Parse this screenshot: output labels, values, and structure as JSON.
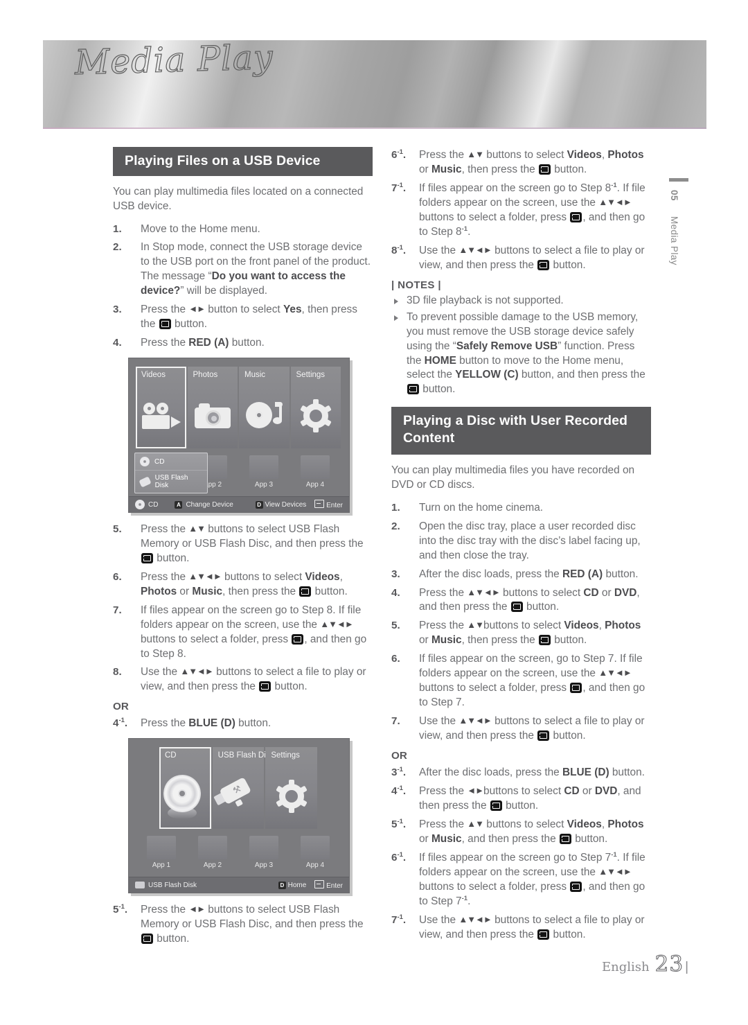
{
  "banner": {
    "title": "Media Play"
  },
  "chapter_tab": {
    "number": "05",
    "name": "Media Play"
  },
  "footer": {
    "language": "English",
    "page": "23",
    "rule": "|"
  },
  "left": {
    "section_title": "Playing Files on a USB Device",
    "intro": "You can play multimedia files located on a connected USB device.",
    "steps": [
      {
        "num": "1.",
        "html": "Move to the Home menu."
      },
      {
        "num": "2.",
        "html": "In Stop mode, connect the USB storage device to the USB port on the front panel of the product. The message “<b>Do you want to access the device?</b>” will be displayed."
      },
      {
        "num": "3.",
        "html": "Press the <span class=\"arw\">◄►</span> button to select <b>Yes</b>, then press the <span class=\"ent\"></span> button."
      },
      {
        "num": "4.",
        "html": "Press the <b>RED (A)</b> button."
      }
    ],
    "steps2": [
      {
        "num": "5.",
        "html": "Press the <span class=\"arw\">▲▼</span> buttons to select USB Flash Memory or USB Flash Disc, and then press the <span class=\"ent\"></span> button."
      },
      {
        "num": "6.",
        "html": "Press the <span class=\"arw\">▲▼◄►</span> buttons to select <b>Videos</b>, <b>Photos</b> or <b>Music</b>, then press the <span class=\"ent\"></span> button."
      },
      {
        "num": "7.",
        "html": "If files appear on the screen go to Step 8. If file folders appear on the screen, use the <span class=\"arw\">▲▼◄►</span> buttons to select a folder, press <span class=\"ent\"></span>, and then go to Step 8."
      },
      {
        "num": "8.",
        "html": "Use the <span class=\"arw\">▲▼◄►</span> buttons to select a file to play or view, and then press the <span class=\"ent\"></span> button."
      }
    ],
    "or_label": "OR",
    "steps3": [
      {
        "num": "4<span class=\"sup\">-1</span>.",
        "html": "Press the <b>BLUE (D)</b> button."
      }
    ],
    "steps4": [
      {
        "num": "5<span class=\"sup\">-1</span>.",
        "html": "Press the <span class=\"arw\">◄►</span> buttons to select USB Flash Memory or USB Flash Disc, and then press the <span class=\"ent\"></span> button."
      }
    ]
  },
  "right": {
    "steps_top": [
      {
        "num": "6<span class=\"sup\">-1</span>.",
        "html": "Press the <span class=\"arw\">▲▼</span> buttons to select <b>Videos</b>, <b>Photos</b> or <b>Music</b>, then press the <span class=\"ent\"></span> button."
      },
      {
        "num": "7<span class=\"sup\">-1</span>.",
        "html": "If files appear on the screen go to Step 8<span class=\"sup\">-1</span>. If file folders appear on the screen, use the <span class=\"arw\">▲▼◄►</span> buttons to select a folder, press <span class=\"ent\"></span>, and then go to Step 8<span class=\"sup\">-1</span>."
      },
      {
        "num": "8<span class=\"sup\">-1</span>.",
        "html": "Use the <span class=\"arw\">▲▼◄►</span> buttons to select a file to play or view, and then press the <span class=\"ent\"></span> button."
      }
    ],
    "notes_title": "| NOTES |",
    "notes": [
      "3D file playback is not supported.",
      "To prevent possible damage to the USB memory, you must remove the USB storage device safely using the “<b>Safely Remove USB</b>” function. Press the <b>HOME</b> button to move to the Home menu, select the <b>YELLOW (C)</b> button, and then press the <span class=\"ent\"></span> button."
    ],
    "section_title": "Playing a Disc with User Recorded Content",
    "intro": "You can play multimedia files you have recorded on DVD or CD discs.",
    "steps": [
      {
        "num": "1.",
        "html": "Turn on the home cinema."
      },
      {
        "num": "2.",
        "html": "Open the disc tray, place a user recorded disc into the disc tray with the disc’s label facing up, and then close the tray."
      },
      {
        "num": "3.",
        "html": "After the disc loads, press the <b>RED (A)</b> button."
      },
      {
        "num": "4.",
        "html": "Press the <span class=\"arw\">▲▼◄►</span> buttons to select <b>CD</b> or <b>DVD</b>, and then press the <span class=\"ent\"></span> button."
      },
      {
        "num": "5.",
        "html": "Press the <span class=\"arw\">▲▼</span>buttons to select <b>Videos</b>, <b>Photos</b> or <b>Music</b>, then press the <span class=\"ent\"></span> button."
      },
      {
        "num": "6.",
        "html": "If files appear on the screen, go to Step 7. If file folders appear on the screen, use the <span class=\"arw\">▲▼◄►</span> buttons to select a folder, press <span class=\"ent\"></span>, and then go to Step 7."
      },
      {
        "num": "7.",
        "html": "Use the <span class=\"arw\">▲▼◄►</span> buttons to select a file to play or view, and then press the <span class=\"ent\"></span> button."
      }
    ],
    "or_label": "OR",
    "steps_or": [
      {
        "num": "3<span class=\"sup\">-1</span>.",
        "html": "After the disc loads, press the <b>BLUE (D)</b> button."
      },
      {
        "num": "4<span class=\"sup\">-1</span>.",
        "html": "Press the <span class=\"arw\">◄►</span>buttons to select <b>CD</b> or <b>DVD</b>, and then press the <span class=\"ent\"></span> button."
      },
      {
        "num": "5<span class=\"sup\">-1</span>.",
        "html": "Press the <span class=\"arw\">▲▼</span> buttons to select <b>Videos</b>, <b>Photos</b> or <b>Music</b>, and then press the <span class=\"ent\"></span> button."
      },
      {
        "num": "6<span class=\"sup\">-1</span>.",
        "html": "If files appear on the screen go to Step 7<span class=\"sup\">-1</span>. If file folders appear on the screen, use the <span class=\"arw\">▲▼◄►</span> buttons to select a folder, press <span class=\"ent\"></span>, and then go to Step 7<span class=\"sup\">-1</span>."
      },
      {
        "num": "7<span class=\"sup\">-1</span>.",
        "html": "Use the <span class=\"arw\">▲▼◄►</span> buttons to select a file to play or view, and then press the <span class=\"ent\"></span> button."
      }
    ]
  },
  "screenshot_home": {
    "panes": [
      {
        "label": "Videos",
        "icon": "video-camera-icon",
        "selected": true
      },
      {
        "label": "Photos",
        "icon": "camera-icon",
        "selected": false
      },
      {
        "label": "Music",
        "icon": "cd-music-note-icon",
        "selected": false
      },
      {
        "label": "Settings",
        "icon": "gear-icon",
        "selected": false
      }
    ],
    "device_popup": [
      {
        "label": "CD",
        "icon": "cd-icon"
      },
      {
        "label": "USB Flash Disk",
        "icon": "usb-icon"
      }
    ],
    "apps": [
      "App 2",
      "App 3",
      "App 4"
    ],
    "status": {
      "device_icon": "cd-icon",
      "device": "CD",
      "key_a": "A",
      "key_a_label": "Change Device",
      "key_d": "D",
      "key_d_label": "View Devices",
      "enter_label": "Enter"
    }
  },
  "screenshot_disc": {
    "panes": [
      {
        "label": "CD",
        "icon": "cd-icon",
        "selected": true
      },
      {
        "label": "USB Flash Disk",
        "icon": "usb-icon",
        "selected": false
      },
      {
        "label": "Settings",
        "icon": "gear-icon",
        "selected": false
      }
    ],
    "apps": [
      "App 1",
      "App 2",
      "App 3",
      "App 4"
    ],
    "status": {
      "device_icon": "usb-device-icon",
      "device": "USB Flash Disk",
      "key_d": "D",
      "key_d_label": "Home",
      "enter_label": "Enter"
    }
  }
}
